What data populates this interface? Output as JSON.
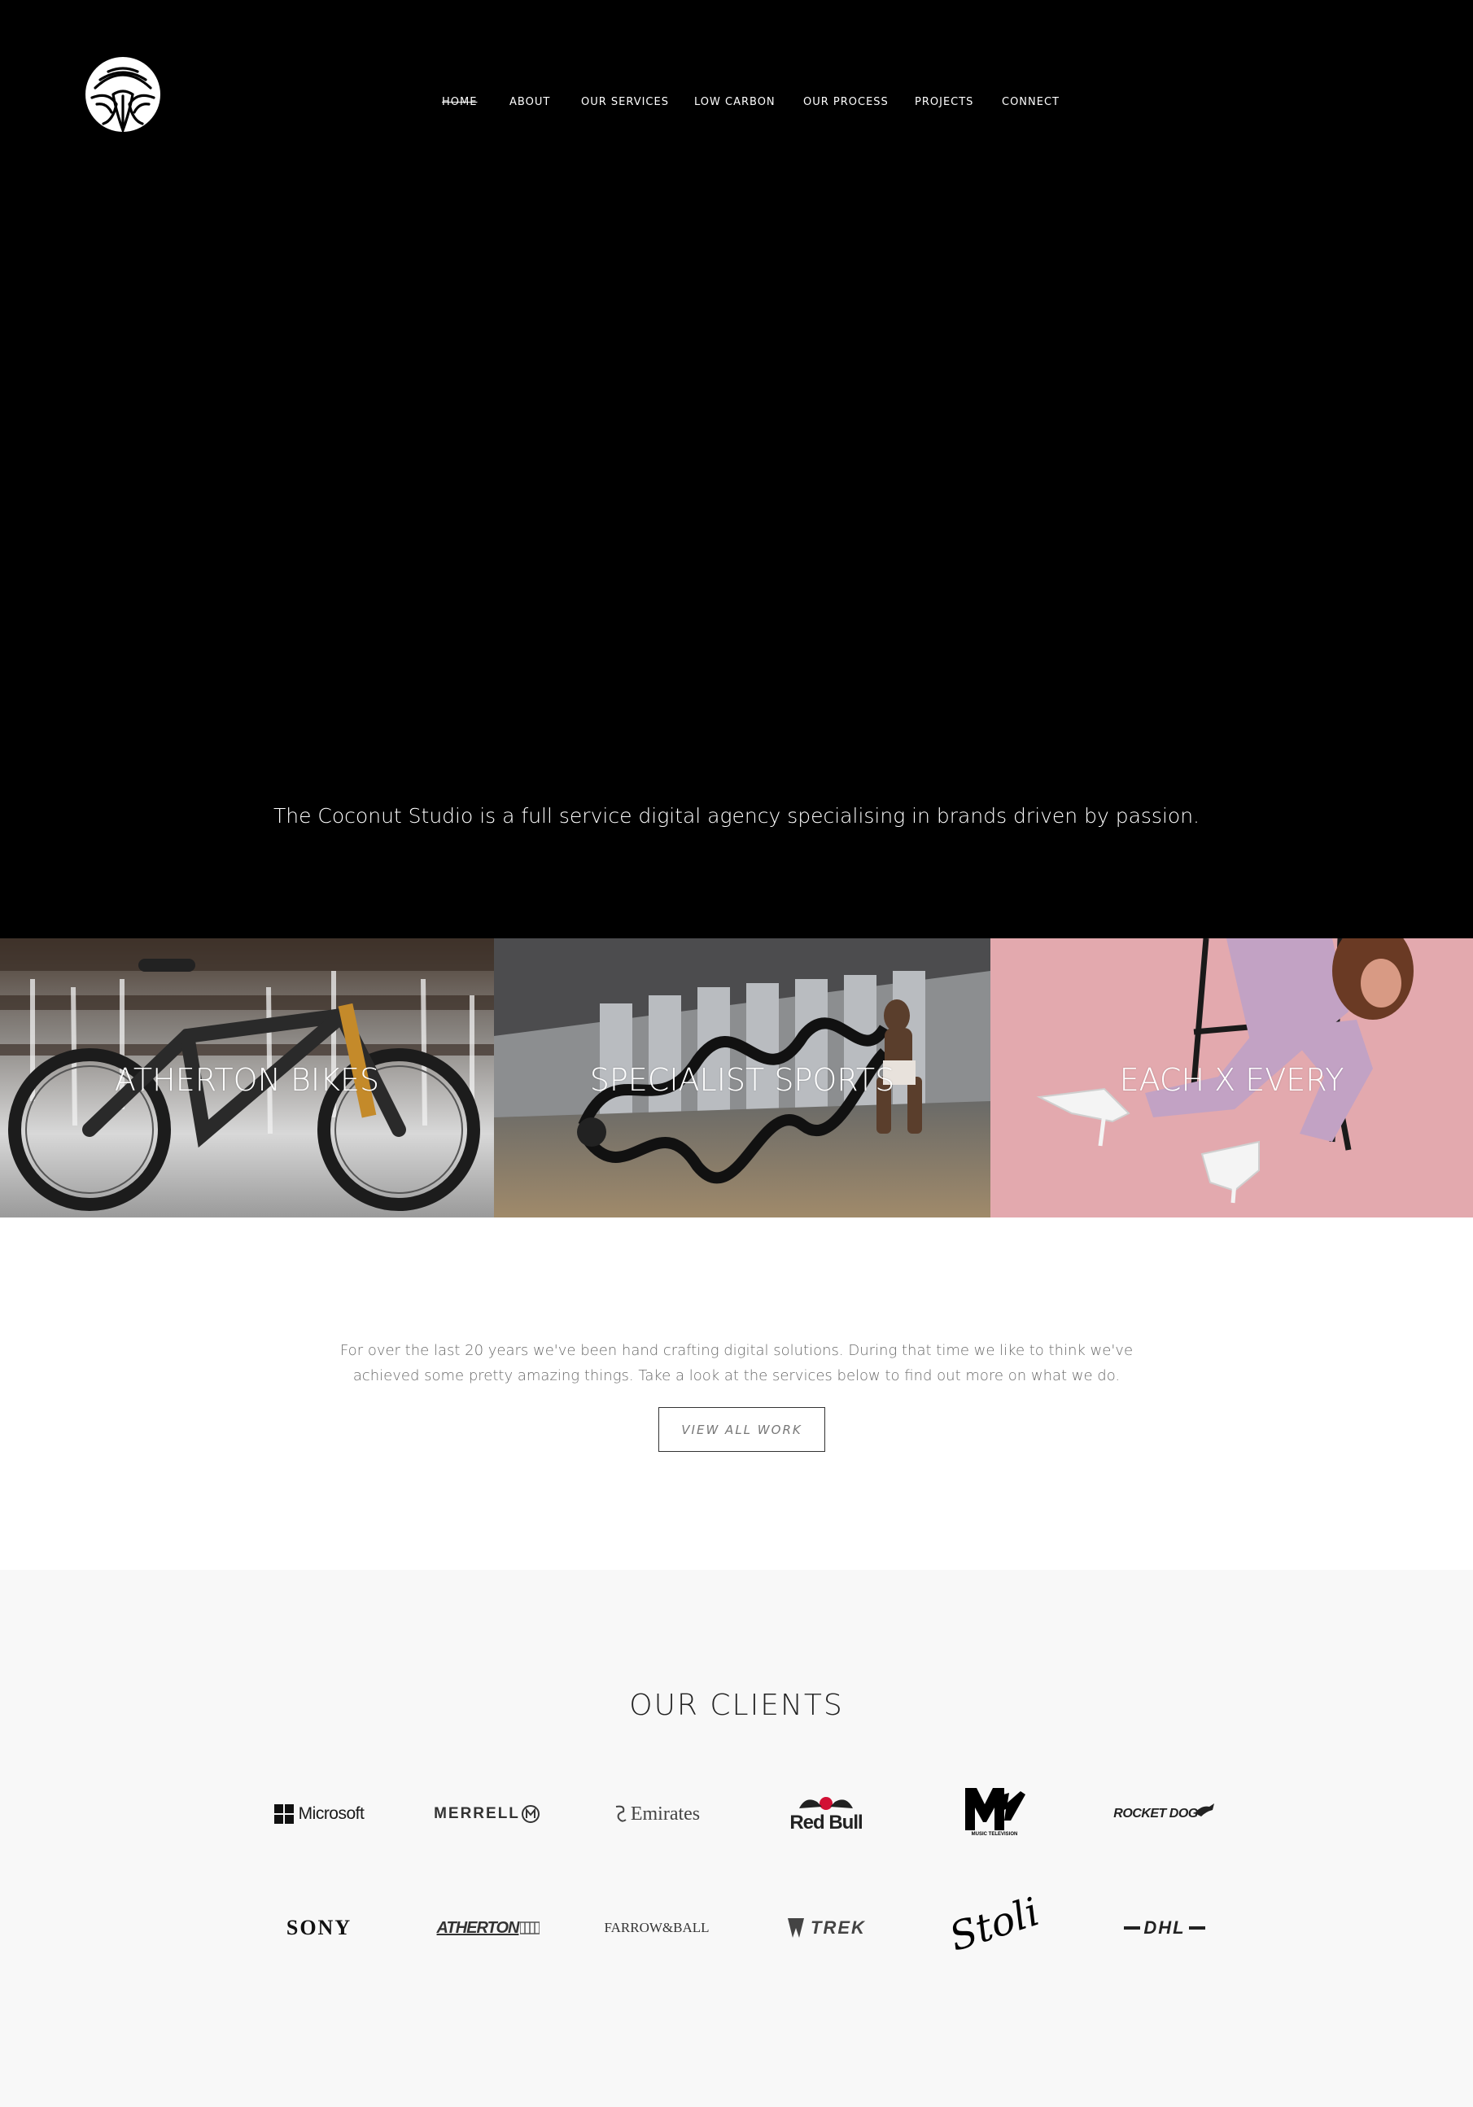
{
  "nav": {
    "items": [
      {
        "label": "HOME",
        "active": true
      },
      {
        "label": "ABOUT"
      },
      {
        "label": "OUR SERVICES"
      },
      {
        "label": "LOW CARBON"
      },
      {
        "label": "OUR PROCESS"
      },
      {
        "label": "PROJECTS"
      },
      {
        "label": "CONNECT"
      }
    ]
  },
  "hero": {
    "tagline": "The Coconut Studio is a full service digital agency specialising in brands driven by passion."
  },
  "projects": [
    {
      "label": "ATHERTON BIKES"
    },
    {
      "label": "SPECIALIST SPORTS"
    },
    {
      "label": "EACH X EVERY"
    }
  ],
  "intro": {
    "text": "For over the last 20 years we've been hand crafting digital solutions. During that time we like to think we've achieved some pretty amazing things. Take a look at the services below to find out more on what we do.",
    "button_label": "VIEW ALL WORK"
  },
  "clients": {
    "title": "OUR CLIENTS",
    "logos": [
      {
        "name": "Microsoft",
        "text": "Microsoft"
      },
      {
        "name": "Merrell",
        "text": "MERRELL"
      },
      {
        "name": "Emirates",
        "text": "Emirates"
      },
      {
        "name": "Red Bull",
        "text": "Red Bull"
      },
      {
        "name": "MTV",
        "text": "MUSIC TELEVISION"
      },
      {
        "name": "Rocket Dog",
        "text": "ROCKET DOG"
      },
      {
        "name": "Sony",
        "text": "SONY"
      },
      {
        "name": "Atherton",
        "text": "ATHERTON"
      },
      {
        "name": "Farrow & Ball",
        "text": "FARROW&BALL"
      },
      {
        "name": "Trek",
        "text": "TREK"
      },
      {
        "name": "Stoli",
        "text": "Stoli"
      },
      {
        "name": "DHL",
        "text": "DHL"
      }
    ]
  },
  "colors": {
    "hero_bg": "#000000",
    "intro_bg": "#ffffff",
    "clients_bg": "#f8f8f8",
    "redbull_red": "#d21034"
  }
}
